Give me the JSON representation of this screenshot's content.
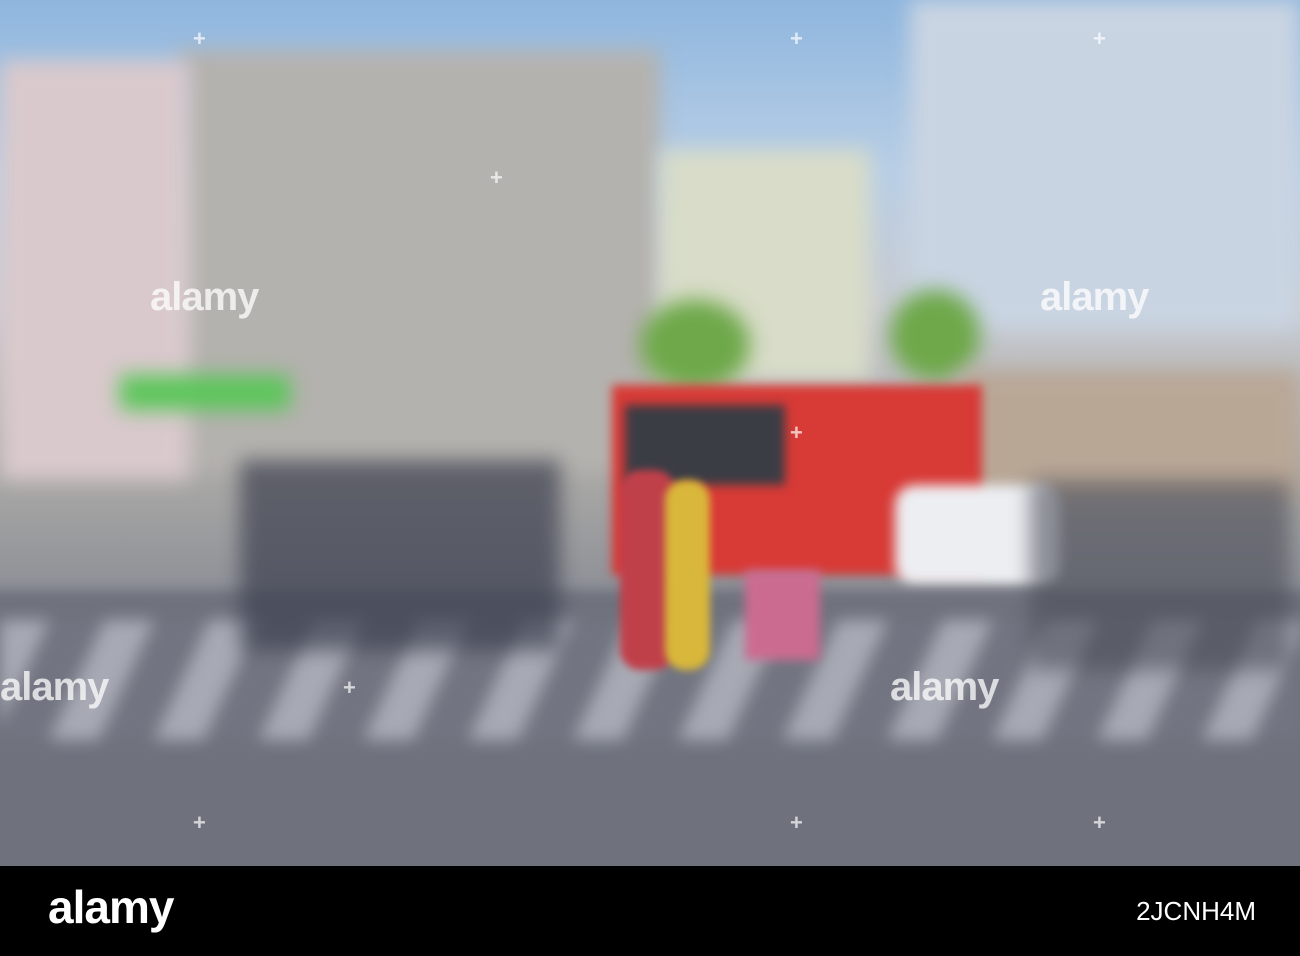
{
  "watermark": {
    "text": "alamy"
  },
  "footer": {
    "brand": "alamy",
    "image_id": "2JCNH4M"
  }
}
